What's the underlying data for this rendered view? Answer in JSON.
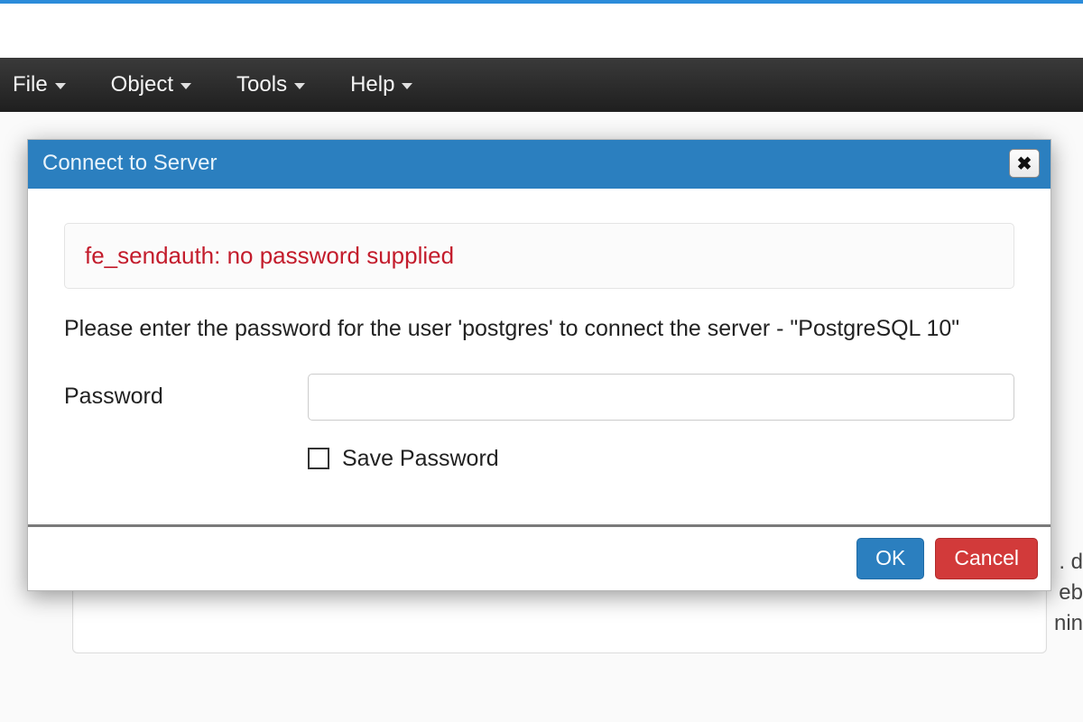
{
  "menubar": {
    "items": [
      {
        "label": "File"
      },
      {
        "label": "Object"
      },
      {
        "label": "Tools"
      },
      {
        "label": "Help"
      }
    ]
  },
  "dialog": {
    "title": "Connect to Server",
    "error_message": "fe_sendauth: no password supplied",
    "prompt": "Please enter the password for the user 'postgres' to connect the server - \"PostgreSQL 10\"",
    "password_label": "Password",
    "password_value": "",
    "save_password_label": "Save Password",
    "save_password_checked": false,
    "ok_label": "OK",
    "cancel_label": "Cancel"
  },
  "background": {
    "fragments": [
      ". d",
      "eb",
      "nin"
    ]
  }
}
